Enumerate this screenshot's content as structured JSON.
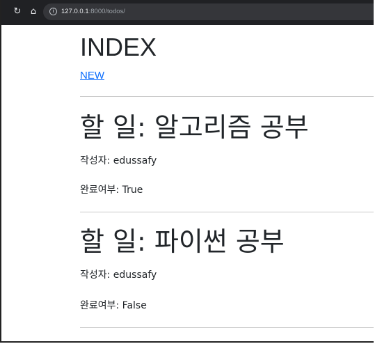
{
  "browser": {
    "reload_icon": "↻",
    "home_icon": "⌂",
    "url_host": "127.0.0.1",
    "url_path": ":8000/todos/"
  },
  "page": {
    "title": "INDEX",
    "new_link": "NEW"
  },
  "todos": [
    {
      "title": "할 일: 알고리즘 공부",
      "author": "작성자: edussafy",
      "completed": "완료여부: True"
    },
    {
      "title": "할 일: 파이썬 공부",
      "author": "작성자: edussafy",
      "completed": "완료여부: False"
    }
  ]
}
